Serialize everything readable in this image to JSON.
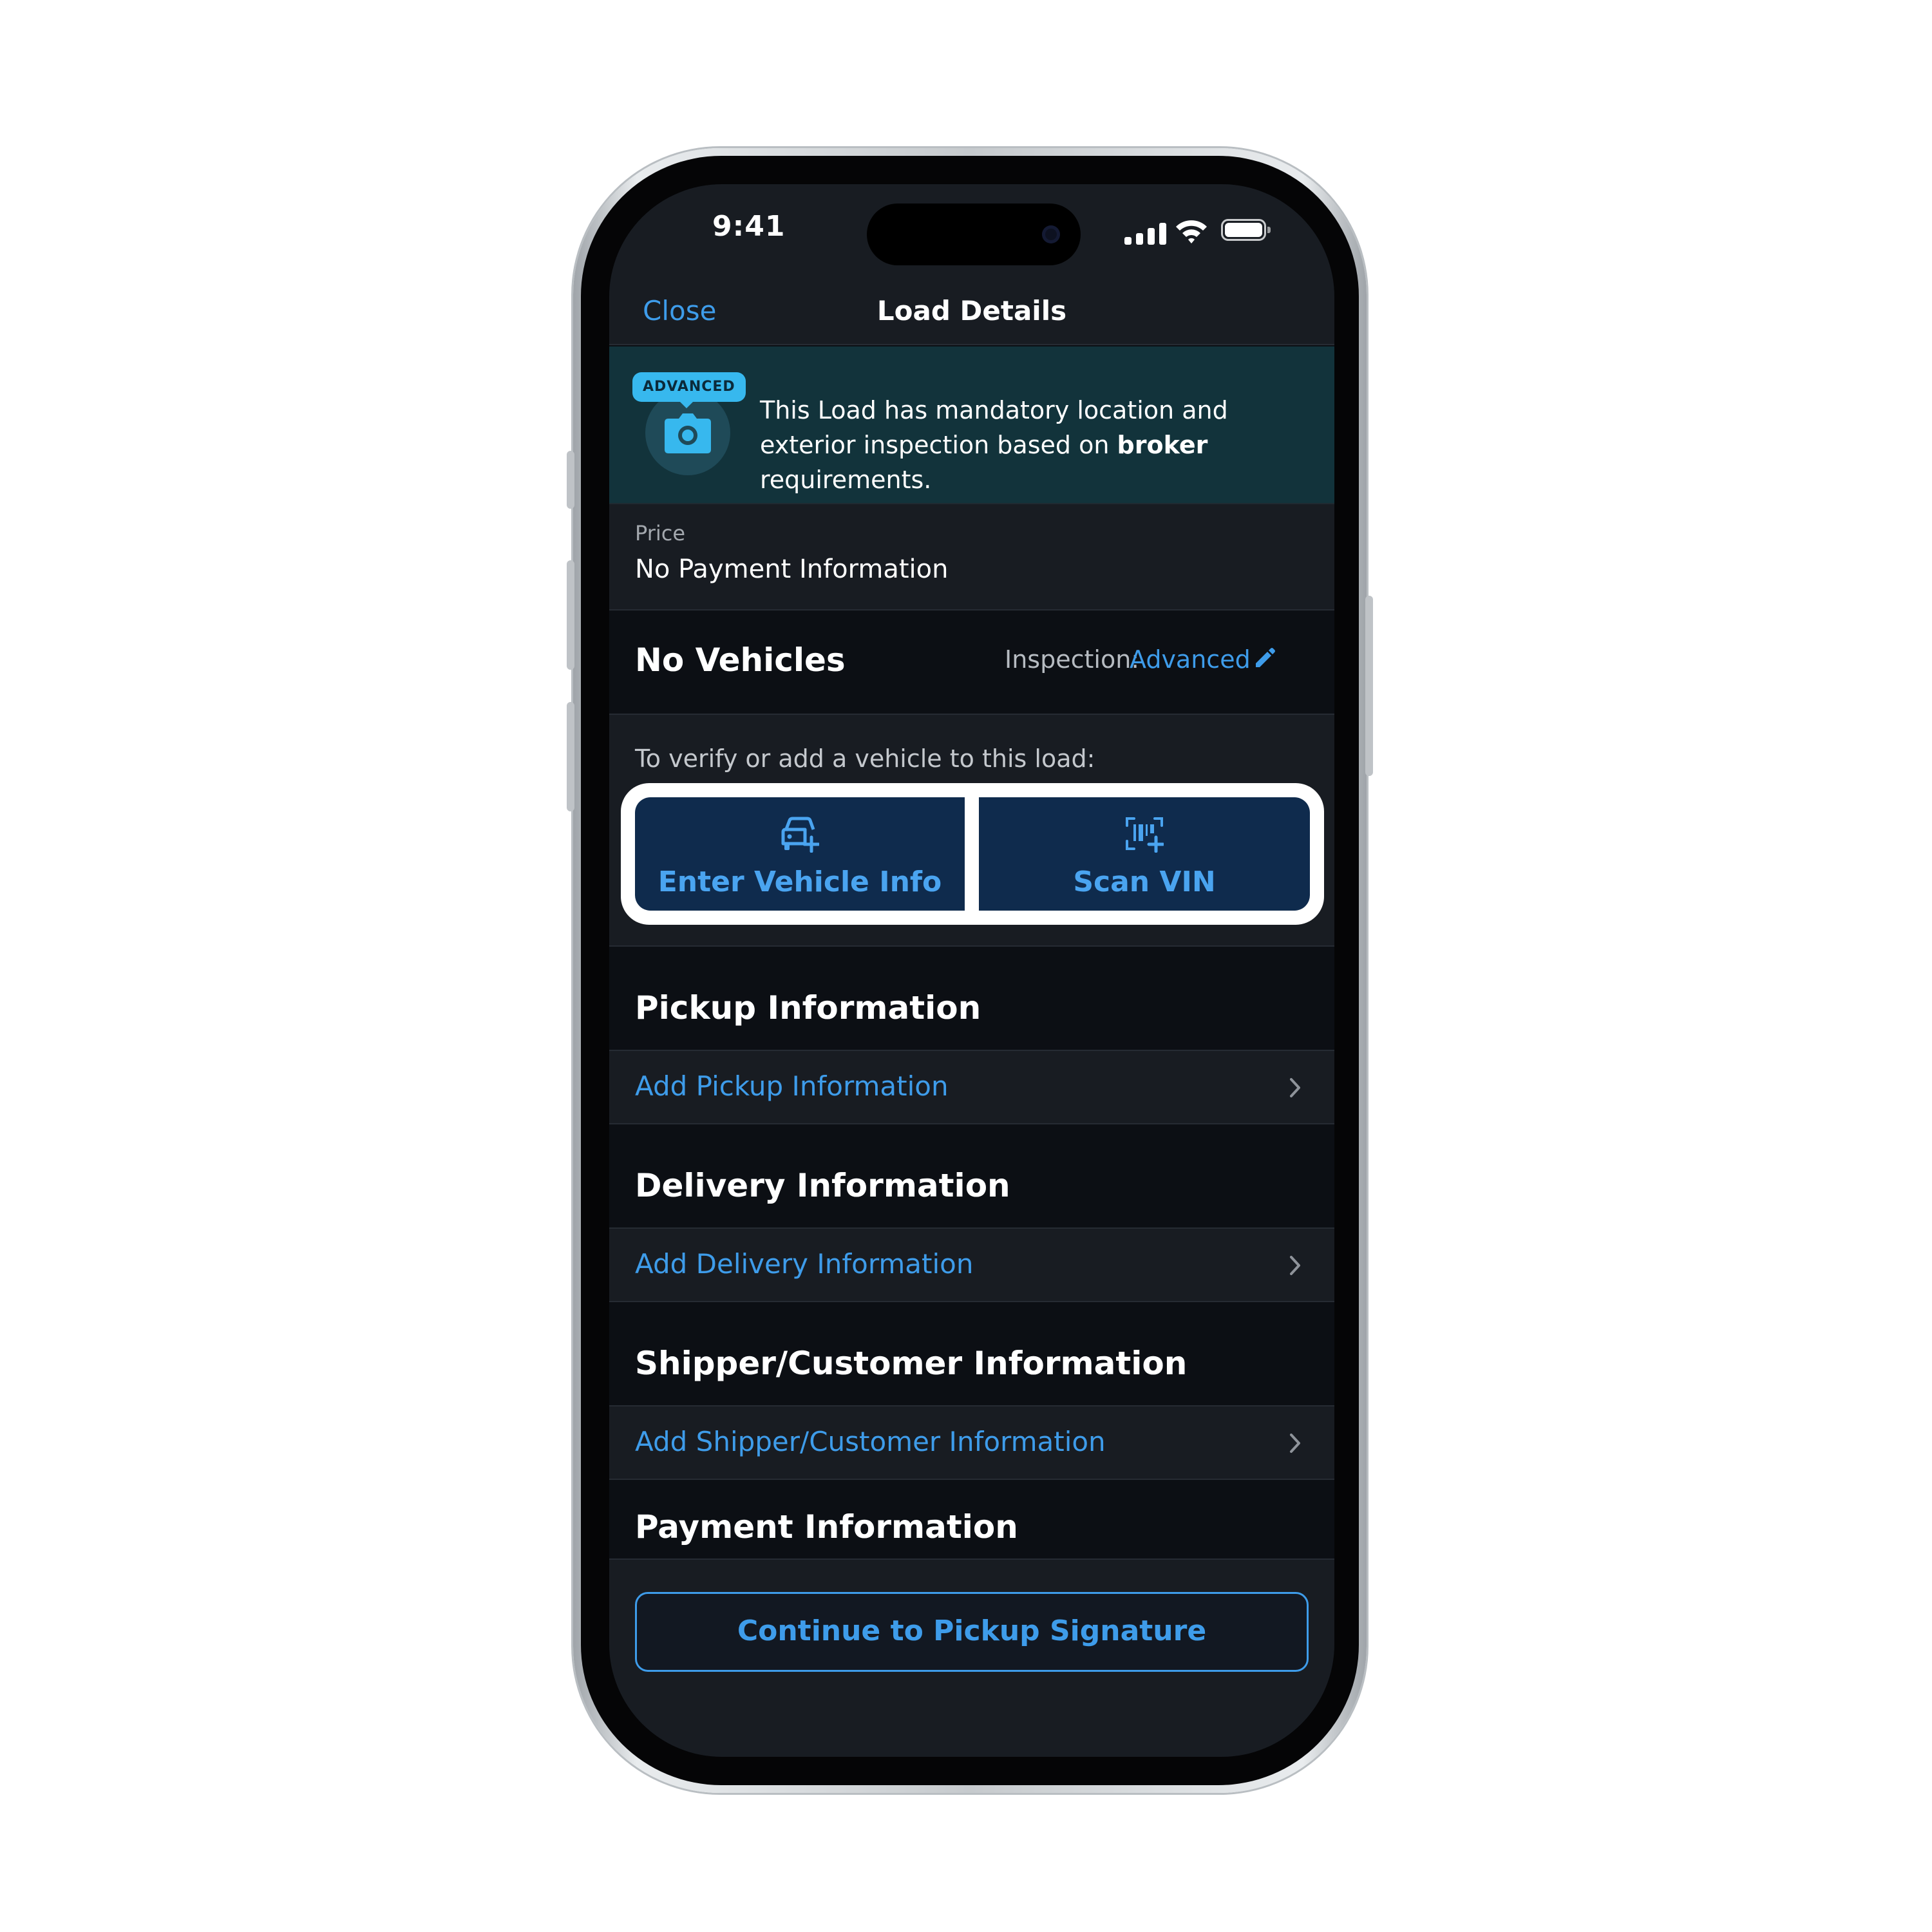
{
  "status_bar": {
    "time": "9:41",
    "icons": [
      "cellular-signal-icon",
      "wifi-icon",
      "battery-icon"
    ]
  },
  "nav": {
    "close_label": "Close",
    "title": "Load Details"
  },
  "banner": {
    "badge": "ADVANCED",
    "icon": "camera-icon",
    "text_before": "This Load has mandatory location and exterior inspection based on ",
    "text_bold": "broker",
    "text_after": " requirements."
  },
  "price": {
    "label": "Price",
    "value": "No Payment Information"
  },
  "vehicles": {
    "title": "No Vehicles",
    "inspection_label": "Inspection:",
    "inspection_value": "Advanced",
    "edit_icon": "pencil-icon"
  },
  "verify": {
    "label": "To verify or add a vehicle to this load:",
    "enter_vehicle_label": "Enter Vehicle Info",
    "enter_vehicle_icon": "car-plus-icon",
    "scan_vin_label": "Scan VIN",
    "scan_vin_icon": "barcode-scan-icon"
  },
  "sections": {
    "pickup": {
      "title": "Pickup Information",
      "link": "Add Pickup Information"
    },
    "delivery": {
      "title": "Delivery Information",
      "link": "Add Delivery Information"
    },
    "shipper": {
      "title": "Shipper/Customer Information",
      "link": "Add Shipper/Customer Information"
    },
    "payment": {
      "title": "Payment Information"
    }
  },
  "footer": {
    "continue_label": "Continue to Pickup Signature"
  },
  "colors": {
    "accent": "#3e9cea",
    "background": "#0c0f14",
    "surface": "#181c22",
    "banner": "#12333b",
    "badge": "#37b8ee",
    "button_fill": "#0f2b4d"
  }
}
